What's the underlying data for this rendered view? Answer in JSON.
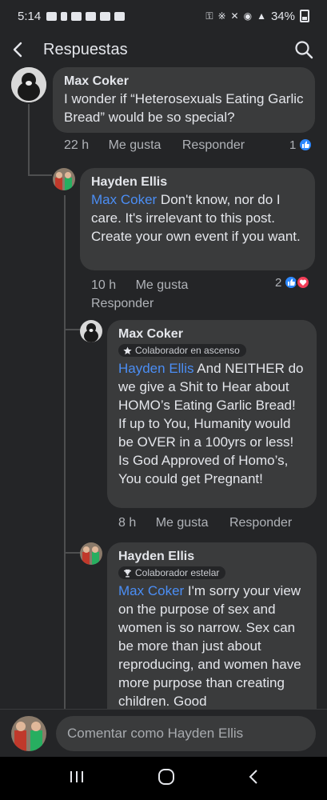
{
  "status_bar": {
    "time": "5:14",
    "battery": "34%"
  },
  "header": {
    "title": "Respuestas"
  },
  "comments": [
    {
      "author": "Max Coker",
      "text": "I wonder if “Heterosexuals Eating Garlic Bread” would be so special?",
      "time": "22 h",
      "like": "Me gusta",
      "reply": "Responder",
      "reactions": "1"
    },
    {
      "author": "Hayden Ellis",
      "mention": "Max Coker",
      "text": " Don't know,  nor do I care.  It's irrelevant to this post.  Create your own event if you want.",
      "time": "10 h",
      "like": "Me gusta",
      "reply": "Responder",
      "reactions": "2"
    },
    {
      "author": "Max Coker",
      "badge": "Colaborador en ascenso",
      "mention": "Hayden Ellis",
      "text": " And NEITHER do we give a Shit to Hear about HOMO’s Eating Garlic Bread! If up to You, Humanity would be OVER in a 100yrs or less! Is God Approved of Homo’s, You could get Pregnant!",
      "time": "8 h",
      "like": "Me gusta",
      "reply": "Responder"
    },
    {
      "author": "Hayden Ellis",
      "badge": "Colaborador estelar",
      "mention": "Max Coker",
      "text": " I'm sorry your view on the purpose of sex and women is so narrow. Sex can be more than just about reproducing, and women have more purpose than creating children. Good"
    }
  ],
  "composer": {
    "placeholder": "Comentar como Hayden Ellis"
  },
  "colors": {
    "background": "#242527",
    "bubble": "#3a3b3c",
    "mention": "#4b8ef5",
    "like": "#2d88ff",
    "love": "#f33e58"
  },
  "icons": [
    "back-arrow-icon",
    "search-icon",
    "like-reaction-icon",
    "love-reaction-icon",
    "star-badge-icon",
    "trophy-badge-icon",
    "recent-apps-icon",
    "home-icon",
    "nav-back-icon"
  ]
}
